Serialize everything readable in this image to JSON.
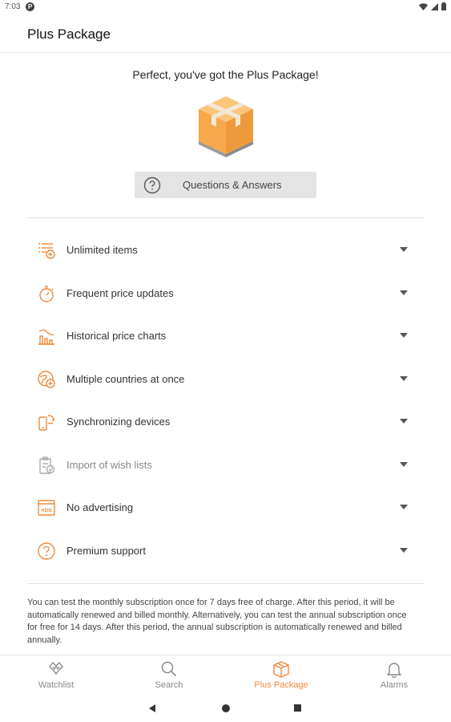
{
  "status_bar": {
    "time": "7:03",
    "p_badge": "P"
  },
  "app_bar": {
    "title": "Plus Package"
  },
  "headline": "Perfect, you've got the Plus Package!",
  "qa_button": {
    "label": "Questions & Answers",
    "icon": "question-circle-icon"
  },
  "features": [
    {
      "label": "Unlimited items",
      "icon": "list-add-icon",
      "muted": false
    },
    {
      "label": "Frequent price updates",
      "icon": "stopwatch-icon",
      "muted": false
    },
    {
      "label": "Historical price charts",
      "icon": "chart-icon",
      "muted": false
    },
    {
      "label": "Multiple countries at once",
      "icon": "globe-add-icon",
      "muted": false
    },
    {
      "label": "Synchronizing devices",
      "icon": "sync-devices-icon",
      "muted": false
    },
    {
      "label": "Import of wish lists",
      "icon": "import-list-icon",
      "muted": true
    },
    {
      "label": "No advertising",
      "icon": "no-ads-icon",
      "muted": false
    },
    {
      "label": "Premium support",
      "icon": "question-circle-icon",
      "muted": false
    }
  ],
  "info_text": "You can test the monthly subscription once for 7 days free of charge. After this period, it will be automatically renewed and billed monthly. Alternatively, you can test the annual subscription once for free for 14 days. After this period, the annual subscription is automatically renewed and billed annually.",
  "bottom_nav": [
    {
      "label": "Watchlist",
      "icon": "watchlist-icon",
      "active": false
    },
    {
      "label": "Search",
      "icon": "search-icon",
      "active": false
    },
    {
      "label": "Plus Package",
      "icon": "package-icon",
      "active": true
    },
    {
      "label": "Alarms",
      "icon": "bell-icon",
      "active": false
    }
  ],
  "colors": {
    "accent": "#f08a3c",
    "box_light": "#f7b25a",
    "box_dark": "#e08c2f"
  }
}
